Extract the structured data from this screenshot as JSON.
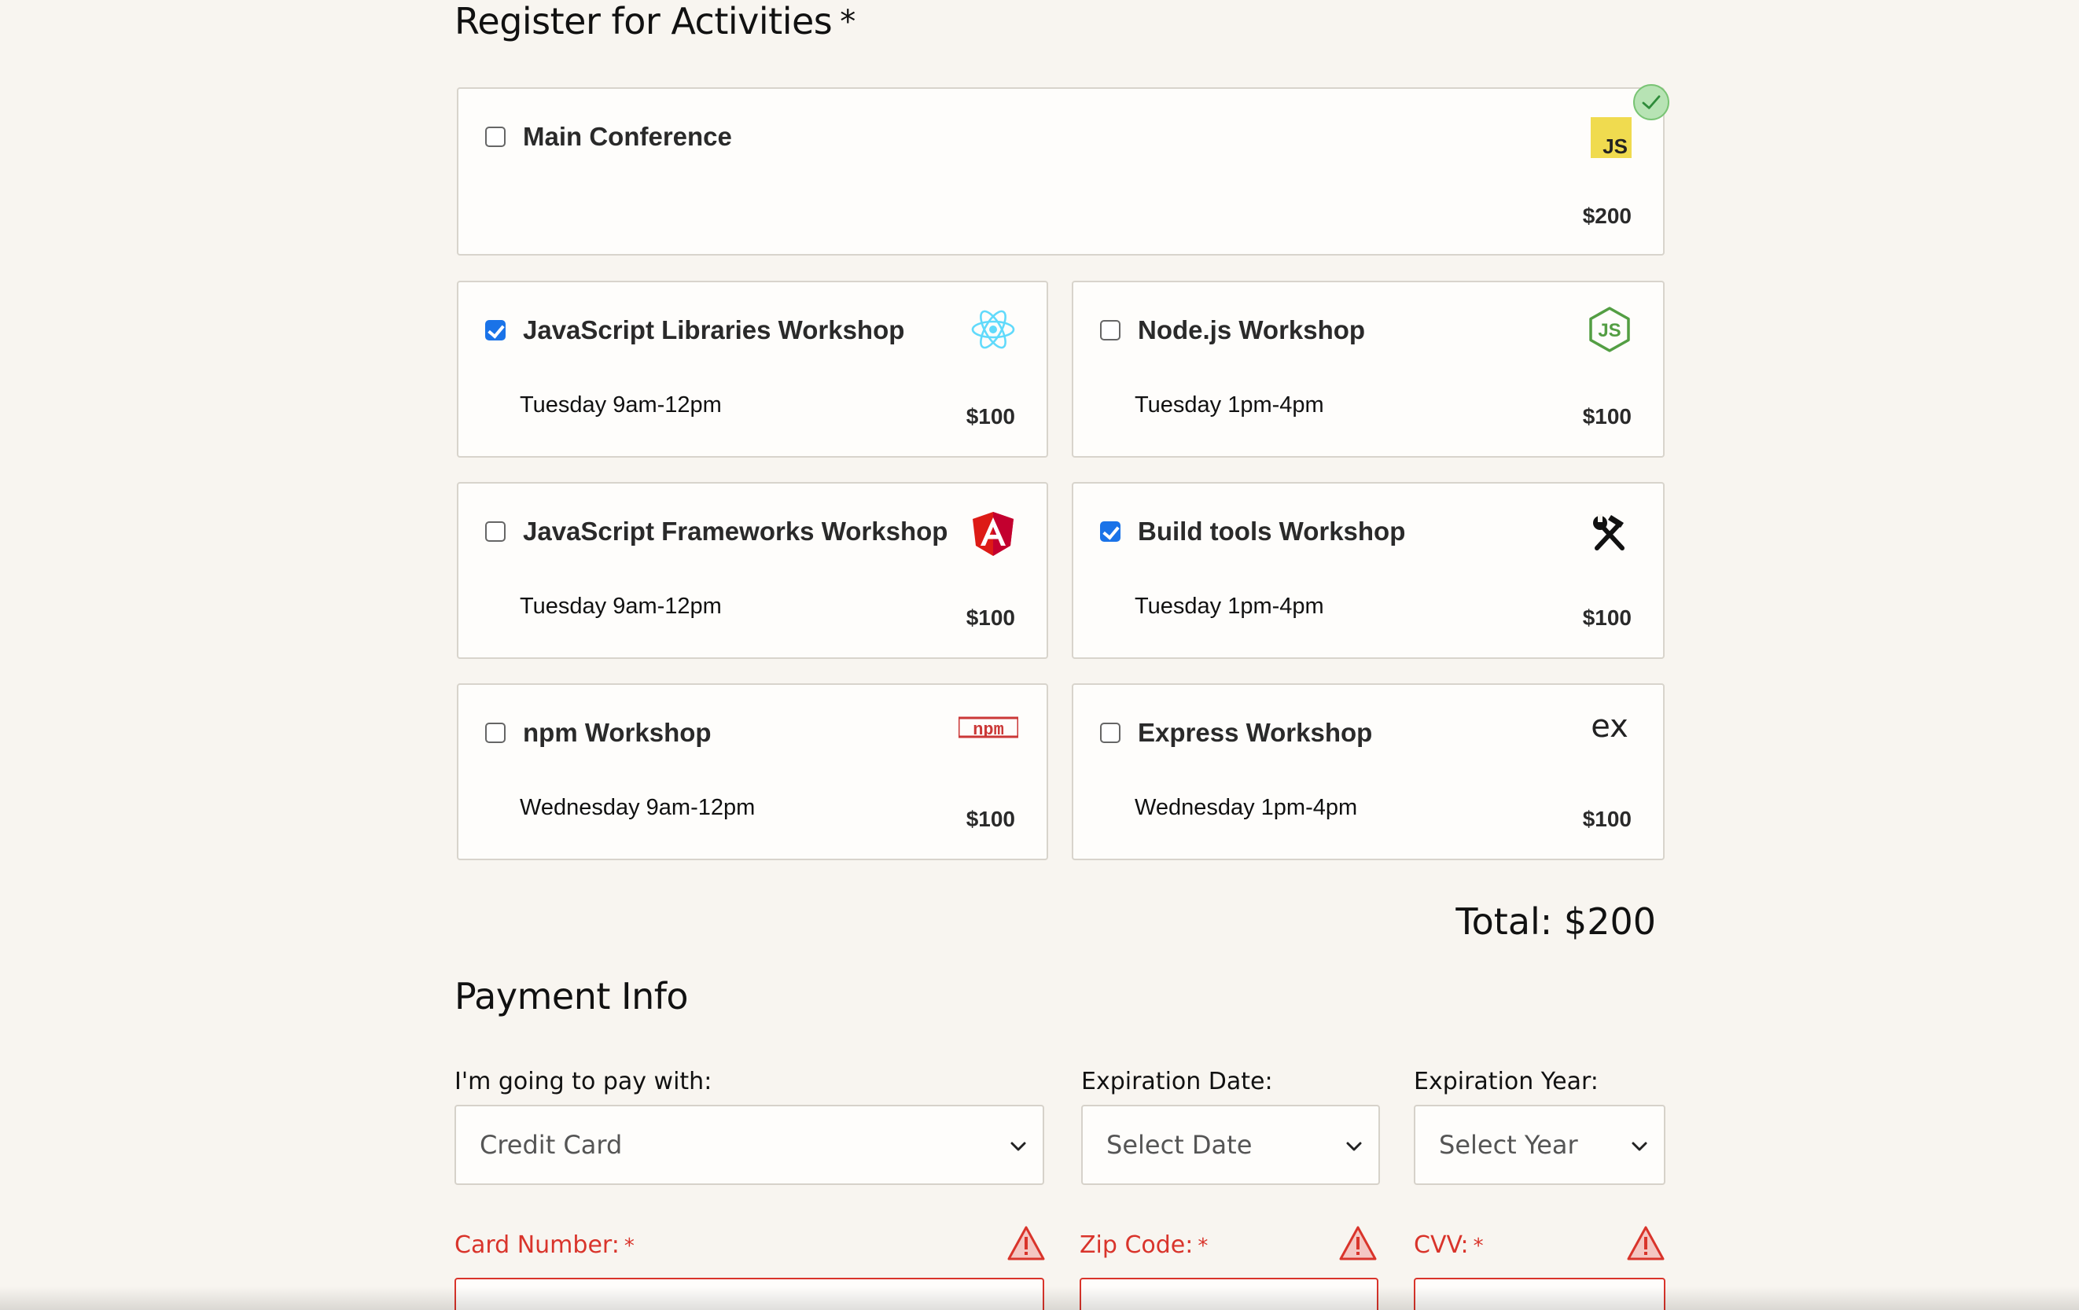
{
  "activities": {
    "title": "Register for Activities",
    "required_mark": "*",
    "main": {
      "name": "Main Conference",
      "price": "$200",
      "checked": false,
      "icon": "javascript-logo-icon",
      "icon_text": "JS"
    },
    "workshops": [
      {
        "name": "JavaScript Libraries Workshop",
        "time": "Tuesday 9am-12pm",
        "price": "$100",
        "checked": true,
        "icon": "react-icon"
      },
      {
        "name": "Node.js Workshop",
        "time": "Tuesday 1pm-4pm",
        "price": "$100",
        "checked": false,
        "icon": "nodejs-icon"
      },
      {
        "name": "JavaScript Frameworks Workshop",
        "time": "Tuesday 9am-12pm",
        "price": "$100",
        "checked": false,
        "icon": "angular-icon"
      },
      {
        "name": "Build tools Workshop",
        "time": "Tuesday 1pm-4pm",
        "price": "$100",
        "checked": true,
        "icon": "hammer-wrench-icon"
      },
      {
        "name": "npm Workshop",
        "time": "Wednesday 9am-12pm",
        "price": "$100",
        "checked": false,
        "icon": "npm-icon"
      },
      {
        "name": "Express Workshop",
        "time": "Wednesday 1pm-4pm",
        "price": "$100",
        "checked": false,
        "icon": "express-icon",
        "icon_text": "ex"
      }
    ],
    "total": "Total: $200"
  },
  "payment": {
    "title": "Payment Info",
    "pay_with_label": "I'm going to pay with:",
    "pay_with_value": "Credit Card",
    "exp_date_label": "Expiration Date:",
    "exp_date_value": "Select Date",
    "exp_year_label": "Expiration Year:",
    "exp_year_value": "Select Year",
    "card_number_label": "Card Number:",
    "zip_label": "Zip Code:",
    "cvv_label": "CVV:",
    "required_mark": "*"
  },
  "colors": {
    "background": "#f8f5f0",
    "checkbox_checked": "#1a73e8",
    "error": "#d9342b",
    "valid": "#79c474"
  }
}
